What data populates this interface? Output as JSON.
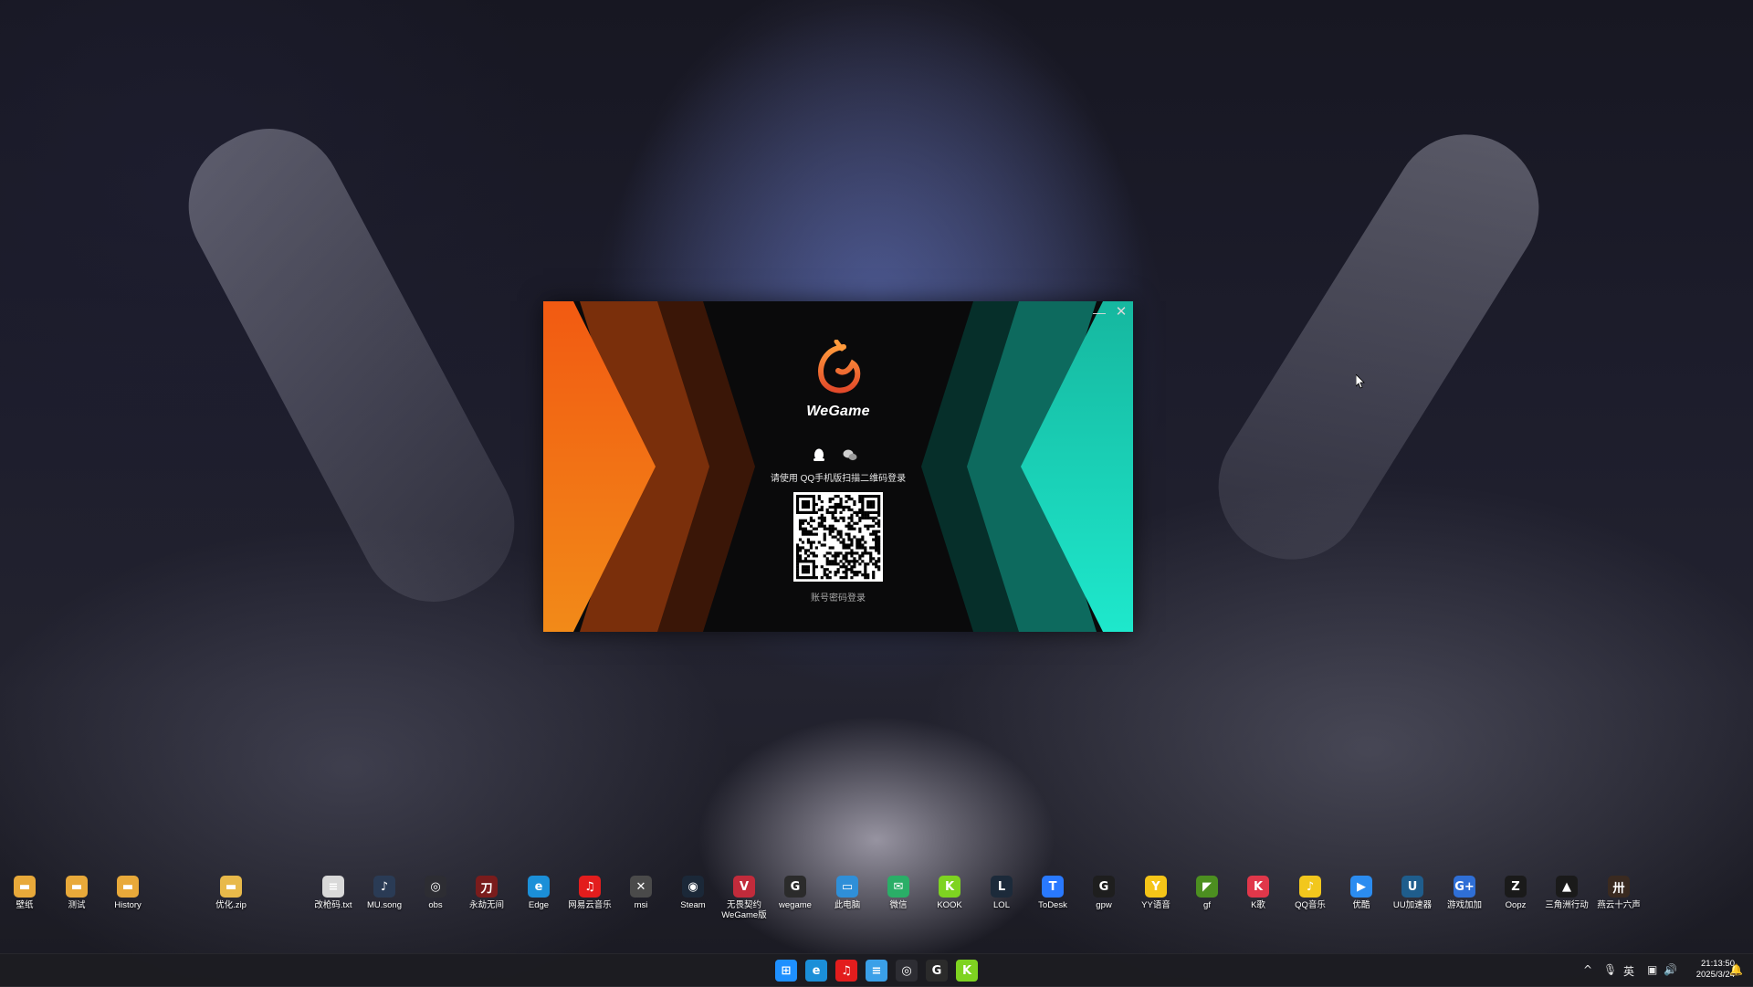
{
  "window": {
    "app_name": "WeGame",
    "minimize_glyph": "—",
    "close_glyph": "✕",
    "instruction": "请使用 QQ手机版扫描二维码登录",
    "account_login": "账号密码登录",
    "tabs": [
      {
        "id": "qq",
        "icon": "qq-penguin-icon"
      },
      {
        "id": "wechat",
        "icon": "wechat-icon"
      }
    ],
    "colors": {
      "orange": "#f26a12",
      "teal": "#19e5c4",
      "background": "#0a0a0b"
    }
  },
  "desktop_icons": [
    {
      "label": "壁纸",
      "icon": "folder-icon",
      "color": "#e8a93a",
      "glyph": "▬"
    },
    {
      "label": "测试",
      "icon": "folder-icon",
      "color": "#e8a93a",
      "glyph": "▬"
    },
    {
      "label": "History",
      "icon": "folder-icon",
      "color": "#e8a93a",
      "glyph": "▬"
    },
    {
      "label": "优化.zip",
      "icon": "zip-folder-icon",
      "color": "#e8b94a",
      "glyph": "▬"
    },
    {
      "label": "改枪码.txt",
      "icon": "text-file-icon",
      "color": "#d9d9d9",
      "glyph": "≡"
    },
    {
      "label": "MU.song",
      "icon": "music-file-icon",
      "color": "#2a3b55",
      "glyph": "♪"
    },
    {
      "label": "obs",
      "icon": "obs-icon",
      "color": "#2d2d33",
      "glyph": "◎"
    },
    {
      "label": "永劫无间",
      "icon": "naraka-icon",
      "color": "#7a1c1c",
      "glyph": "刀"
    },
    {
      "label": "Edge",
      "icon": "edge-icon",
      "color": "#1b8fd8",
      "glyph": "e"
    },
    {
      "label": "网易云音乐",
      "icon": "netease-music-icon",
      "color": "#e31d1d",
      "glyph": "♫"
    },
    {
      "label": "msi",
      "icon": "xbox-icon",
      "color": "#4a4a4a",
      "glyph": "✕"
    },
    {
      "label": "Steam",
      "icon": "steam-icon",
      "color": "#1b2838",
      "glyph": "◉"
    },
    {
      "label": "无畏契约\nWeGame版",
      "icon": "valorant-icon",
      "color": "#c22b3b",
      "glyph": "V"
    },
    {
      "label": "wegame",
      "icon": "wegame-icon",
      "color": "#2b2b2b",
      "glyph": "G"
    },
    {
      "label": "此电脑",
      "icon": "this-pc-icon",
      "color": "#2f8fd8",
      "glyph": "▭"
    },
    {
      "label": "微信",
      "icon": "wechat-icon",
      "color": "#2aae67",
      "glyph": "✉"
    },
    {
      "label": "KOOK",
      "icon": "kook-icon",
      "color": "#7ed321",
      "glyph": "K"
    },
    {
      "label": "LOL",
      "icon": "lol-icon",
      "color": "#1c2a3a",
      "glyph": "L"
    },
    {
      "label": "ToDesk",
      "icon": "todesk-icon",
      "color": "#2979ff",
      "glyph": "T"
    },
    {
      "label": "gpw",
      "icon": "logitech-g-icon",
      "color": "#1e1e1e",
      "glyph": "G"
    },
    {
      "label": "YY语音",
      "icon": "yy-icon",
      "color": "#f5c518",
      "glyph": "Y"
    },
    {
      "label": "gf",
      "icon": "nvidia-icon",
      "color": "#4c8f20",
      "glyph": "◤"
    },
    {
      "label": "K歌",
      "icon": "karaoke-icon",
      "color": "#e0374a",
      "glyph": "K"
    },
    {
      "label": "QQ音乐",
      "icon": "qq-music-icon",
      "color": "#f2c71d",
      "glyph": "♪"
    },
    {
      "label": "优酷",
      "icon": "youku-icon",
      "color": "#2b8cf0",
      "glyph": "▶"
    },
    {
      "label": "UU加速器",
      "icon": "uu-booster-icon",
      "color": "#1f5d8c",
      "glyph": "U"
    },
    {
      "label": "游戏加加",
      "icon": "game-plus-icon",
      "color": "#2f6fd6",
      "glyph": "G+"
    },
    {
      "label": "Oopz",
      "icon": "oopz-icon",
      "color": "#1a1a1a",
      "glyph": "Z"
    },
    {
      "label": "三角洲行动",
      "icon": "delta-force-icon",
      "color": "#1a1a1a",
      "glyph": "▲"
    },
    {
      "label": "燕云十六声",
      "icon": "yanyun-icon",
      "color": "#3a2a20",
      "glyph": "卅"
    }
  ],
  "taskbar": {
    "apps": [
      {
        "icon": "windows-start-icon",
        "color": "#1e90ff",
        "glyph": "⊞"
      },
      {
        "icon": "edge-icon",
        "color": "#1b8fd8",
        "glyph": "e"
      },
      {
        "icon": "netease-music-icon",
        "color": "#e31d1d",
        "glyph": "♫"
      },
      {
        "icon": "notepad-icon",
        "color": "#3aa0e8",
        "glyph": "≡"
      },
      {
        "icon": "obs-icon",
        "color": "#2d2d33",
        "glyph": "◎"
      },
      {
        "icon": "wegame-icon",
        "color": "#2b2b2b",
        "glyph": "G"
      },
      {
        "icon": "kook-icon",
        "color": "#7ed321",
        "glyph": "K"
      }
    ],
    "tray": {
      "chevron": "^",
      "ime": "英",
      "time": "21:13:50",
      "date": "2025/3/24"
    }
  }
}
